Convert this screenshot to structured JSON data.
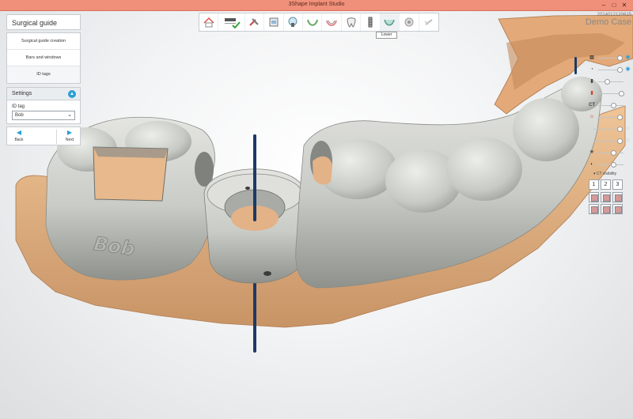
{
  "window": {
    "title": "3Shape Implant Studio",
    "controls": {
      "minimize": "–",
      "maximize": "□",
      "close": "✕"
    }
  },
  "left_panel": {
    "title": "Surgical guide",
    "steps": [
      {
        "label": "Surgical guide creation",
        "active": false
      },
      {
        "label": "Bars and windows",
        "active": false
      },
      {
        "label": "ID tags",
        "active": true
      }
    ],
    "settings": {
      "header": "Settings",
      "id_tag_label": "ID tag",
      "id_tag_value": "Bob"
    },
    "nav": {
      "back": "Back",
      "next": "Next"
    }
  },
  "toolbar": {
    "buttons": [
      {
        "icon": "home-icon"
      },
      {
        "icon": "plan-checked-icon"
      },
      {
        "icon": "tools-icon"
      },
      {
        "icon": "scan-icon"
      },
      {
        "icon": "implant-icon"
      },
      {
        "icon": "arch-icon"
      },
      {
        "icon": "lower-jaw-icon"
      },
      {
        "icon": "tooth-icon"
      },
      {
        "icon": "surgical-guide-icon"
      },
      {
        "icon": "lower-icon"
      },
      {
        "icon": "export-icon"
      },
      {
        "icon": "link-icon"
      }
    ],
    "tooltip": "Lower"
  },
  "case_info": {
    "id": "2014012120615",
    "name": "Demo Case"
  },
  "right_panel": {
    "sliders": [
      {
        "icon": "model-icon",
        "level": 0.85
      },
      {
        "icon": "guide-icon",
        "level": 0.85
      },
      {
        "icon": "implant-icon",
        "level": 0.35
      },
      {
        "icon": "sleeve-icon",
        "level": 0.9
      },
      {
        "icon": "ct-icon",
        "label": "CT",
        "level": 0.6
      },
      {
        "icon": "tooth-icon",
        "level": 0.85
      },
      {
        "icon": "nerve-icon",
        "level": 0.85
      },
      {
        "icon": "crown-icon",
        "level": 0.85
      },
      {
        "icon": "brightness-icon",
        "level": 0.6
      },
      {
        "icon": "contrast-icon",
        "level": 0.6
      }
    ],
    "ct_visibility_label": "CT visibility",
    "ct_buttons": [
      "1",
      "2",
      "3"
    ]
  },
  "scene": {
    "tag_text": "Bob",
    "colors": {
      "guide": "#c9cbc6",
      "guide_shade": "#9a9c97",
      "tissue": "#e9b98c",
      "tissue_shade": "#c08a5e",
      "pin": "#1d3a66",
      "accent": "#2a9fd6"
    }
  }
}
